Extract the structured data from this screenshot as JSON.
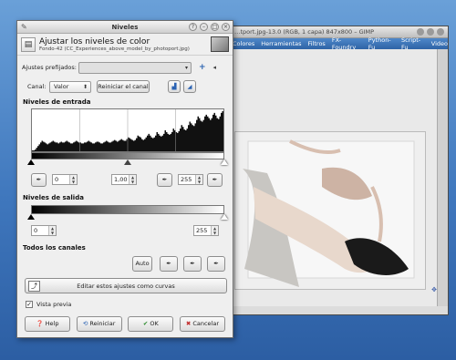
{
  "gimp": {
    "title": "…tport.jpg-13.0 (RGB, 1 capa) 847x800 – GIMP",
    "menu": [
      "Colores",
      "Herramientas",
      "Filtros",
      "FX-Foundry",
      "Python-Fu",
      "Script-Fu",
      "Video"
    ]
  },
  "dialog": {
    "title": "Niveles",
    "header_title": "Ajustar los niveles de color",
    "header_subtitle": "Fondo-42 (CC_Experiences_above_model_by_photoport.jpg)",
    "presets_label": "Ajustes prefijados:",
    "presets_value": "",
    "channel_label": "Canal:",
    "channel_value": "Valor",
    "reset_channel": "Reiniciar el canal",
    "input_levels_label": "Niveles de entrada",
    "input_low": "0",
    "input_gamma": "1,00",
    "input_high": "255",
    "output_levels_label": "Niveles de salida",
    "output_low": "0",
    "output_high": "255",
    "all_channels_label": "Todos los canales",
    "auto_label": "Auto",
    "edit_curves_label": "Editar estos ajustes como curvas",
    "preview_label": "Vista previa",
    "preview_checked": true,
    "help_label": "Help",
    "reset_label": "Reiniciar",
    "ok_label": "OK",
    "cancel_label": "Cancelar"
  },
  "histogram": [
    1,
    1,
    2,
    4,
    6,
    8,
    10,
    12,
    11,
    10,
    9,
    8,
    9,
    10,
    11,
    12,
    11,
    10,
    10,
    9,
    10,
    11,
    10,
    10,
    11,
    12,
    11,
    10,
    9,
    9,
    10,
    11,
    12,
    11,
    10,
    10,
    9,
    9,
    10,
    10,
    11,
    12,
    11,
    10,
    9,
    9,
    10,
    11,
    11,
    10,
    9,
    9,
    10,
    11,
    12,
    11,
    10,
    10,
    11,
    12,
    13,
    12,
    11,
    12,
    13,
    14,
    13,
    12,
    12,
    14,
    16,
    15,
    14,
    13,
    12,
    13,
    15,
    18,
    17,
    16,
    14,
    13,
    14,
    16,
    18,
    20,
    18,
    16,
    15,
    16,
    18,
    22,
    20,
    18,
    17,
    18,
    20,
    24,
    22,
    20,
    19,
    20,
    22,
    26,
    24,
    22,
    21,
    23,
    26,
    30,
    28,
    25,
    24,
    26,
    30,
    34,
    32,
    30,
    29,
    32,
    36,
    40,
    38,
    35,
    34,
    36,
    40,
    42,
    40,
    38,
    36,
    38,
    42,
    44,
    41,
    38,
    37,
    40,
    44,
    46
  ]
}
